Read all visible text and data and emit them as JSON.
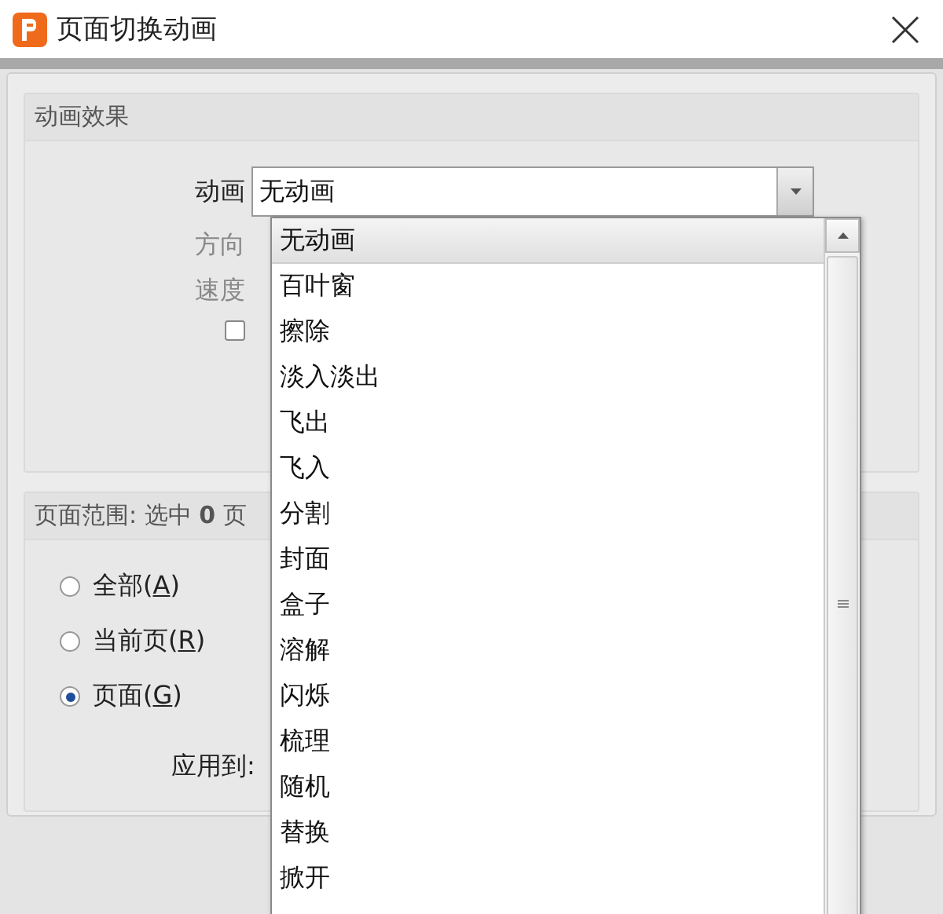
{
  "window": {
    "title": "页面切换动画"
  },
  "effects": {
    "title": "动画效果",
    "fields": [
      {
        "label": "动画",
        "value": "无动画",
        "disabled": false
      },
      {
        "label": "方向",
        "disabled": true
      },
      {
        "label": "速度",
        "disabled": true
      }
    ],
    "checkbox": {
      "checked": false
    }
  },
  "range": {
    "title": "页面范围: 选中 **0** 页",
    "radios": [
      {
        "before": "全部(",
        "mnemonic": "A",
        "after": ")",
        "selected": false
      },
      {
        "before": "当前页(",
        "mnemonic": "R",
        "after": ")",
        "selected": false
      },
      {
        "before": "页面(",
        "mnemonic": "G",
        "after": ")",
        "selected": true
      }
    ],
    "apply_to": "应用到:"
  },
  "dropdown": {
    "items": [
      {
        "label": "无动画",
        "selected": true
      },
      {
        "label": "百叶窗",
        "selected": false
      },
      {
        "label": "擦除",
        "selected": false
      },
      {
        "label": "淡入淡出",
        "selected": false
      },
      {
        "label": "飞出",
        "selected": false
      },
      {
        "label": "飞入",
        "selected": false
      },
      {
        "label": "分割",
        "selected": false
      },
      {
        "label": "封面",
        "selected": false
      },
      {
        "label": "盒子",
        "selected": false
      },
      {
        "label": "溶解",
        "selected": false
      },
      {
        "label": "闪烁",
        "selected": false
      },
      {
        "label": "梳理",
        "selected": false
      },
      {
        "label": "随机",
        "selected": false
      },
      {
        "label": "替换",
        "selected": false
      },
      {
        "label": "掀开",
        "selected": false
      }
    ]
  }
}
